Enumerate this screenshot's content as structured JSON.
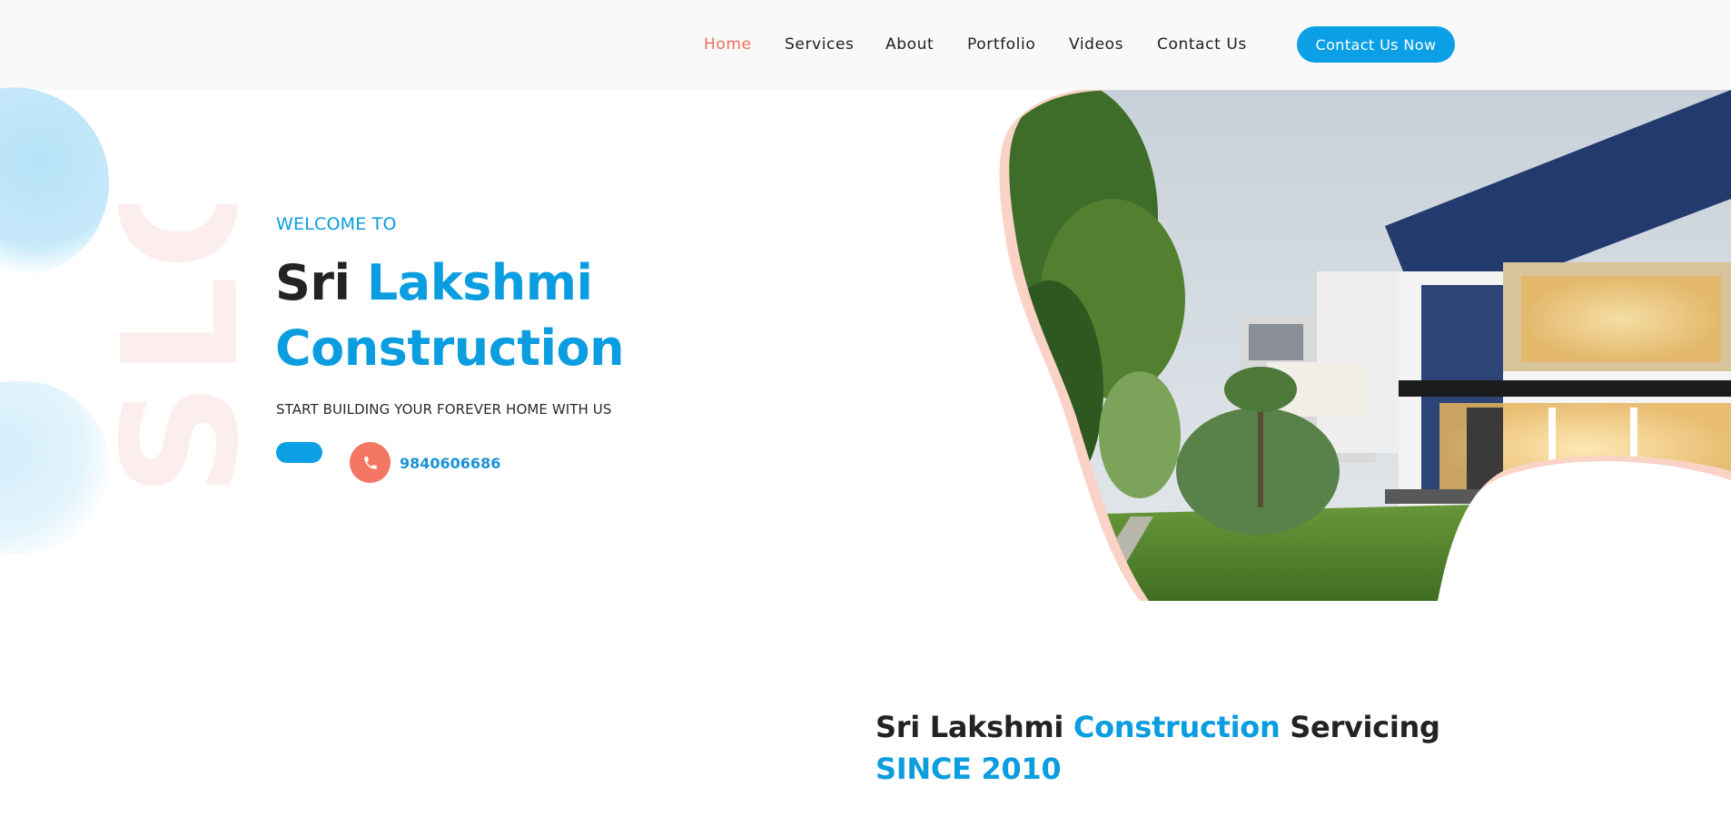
{
  "nav": {
    "links": [
      {
        "label": "Home",
        "active": true
      },
      {
        "label": "Services",
        "active": false
      },
      {
        "label": "About",
        "active": false
      },
      {
        "label": "Portfolio",
        "active": false
      },
      {
        "label": "Videos",
        "active": false
      },
      {
        "label": "Contact Us",
        "active": false
      }
    ],
    "cta_label": "Contact Us Now"
  },
  "hero": {
    "watermark": "SLC",
    "welcome": "WELCOME TO",
    "title_part1": "Sri",
    "title_part2": "Lakshmi",
    "title_part3": "Construction",
    "subtitle": "START BUILDING YOUR FOREVER HOME WITH US",
    "phone": "9840606686",
    "phone_icon": "phone-icon"
  },
  "section2": {
    "title_part1": "Sri Lakshmi",
    "title_part2": "Construction",
    "title_part3": "Servicing",
    "subtitle": "SINCE 2010"
  },
  "colors": {
    "accent_blue": "#0ba0e6",
    "accent_coral": "#f47763",
    "nav_active": "#f06e5e"
  }
}
